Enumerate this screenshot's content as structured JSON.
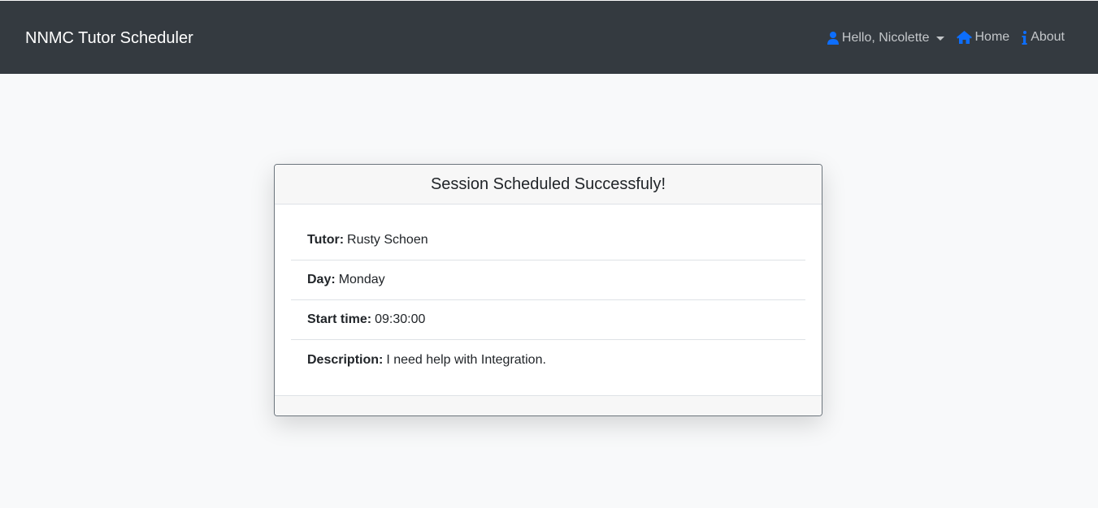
{
  "navbar": {
    "brand": "NNMC Tutor Scheduler",
    "user_label": "Hello, Nicolette",
    "home_label": "Home",
    "about_label": "About",
    "icon_color": "#0d6efd"
  },
  "card": {
    "title": "Session Scheduled Successfuly!",
    "items": [
      {
        "label": "Tutor:",
        "value": "Rusty Schoen"
      },
      {
        "label": "Day:",
        "value": "Monday"
      },
      {
        "label": "Start time:",
        "value": "09:30:00"
      },
      {
        "label": "Description:",
        "value": "I need help with Integration."
      }
    ]
  }
}
